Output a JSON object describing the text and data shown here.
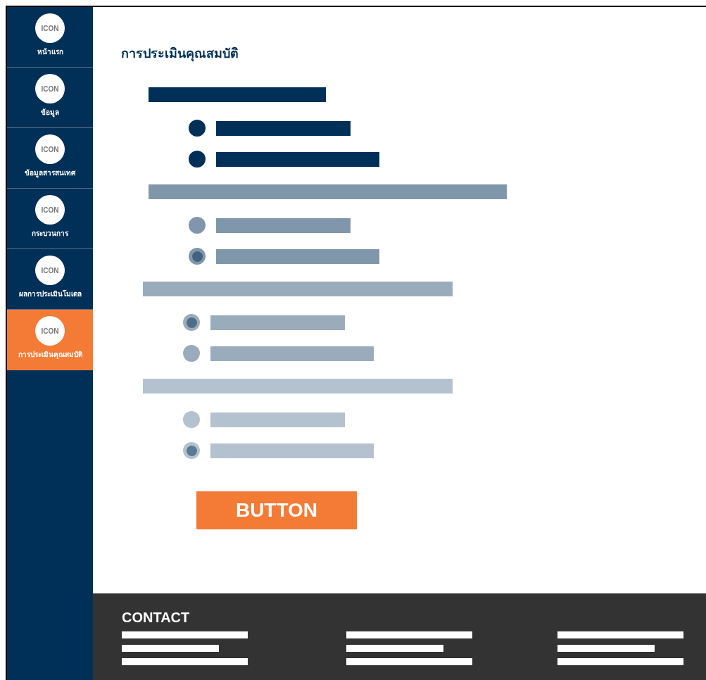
{
  "sidebar": {
    "items": [
      {
        "icon_label": "ICON",
        "label": "หน้าแรก",
        "selected": false
      },
      {
        "icon_label": "ICON",
        "label": "ข้อมูล",
        "selected": false
      },
      {
        "icon_label": "ICON",
        "label": "ข้อมูลสารสนเทศ",
        "selected": false
      },
      {
        "icon_label": "ICON",
        "label": "กระบวนการ",
        "selected": false
      },
      {
        "icon_label": "ICON",
        "label": "ผลการประเมินโมเดล",
        "selected": false
      },
      {
        "icon_label": "ICON",
        "label": "การประเมินคุณสมบัติ",
        "selected": true
      }
    ]
  },
  "page_title": "การประเมินคุณสมบัติ",
  "questions": [
    {
      "color": "#003057",
      "options": [
        {
          "selected": false
        },
        {
          "selected": false
        }
      ]
    },
    {
      "color": "#8097ab",
      "options": [
        {
          "selected": false
        },
        {
          "selected": true
        }
      ]
    },
    {
      "color": "#9aacbb",
      "options": [
        {
          "selected": true
        },
        {
          "selected": false
        }
      ]
    },
    {
      "color": "#b4c2cf",
      "options": [
        {
          "selected": false
        },
        {
          "selected": true
        }
      ]
    }
  ],
  "button": "BUTTON",
  "footer": {
    "title": "CONTACT"
  }
}
